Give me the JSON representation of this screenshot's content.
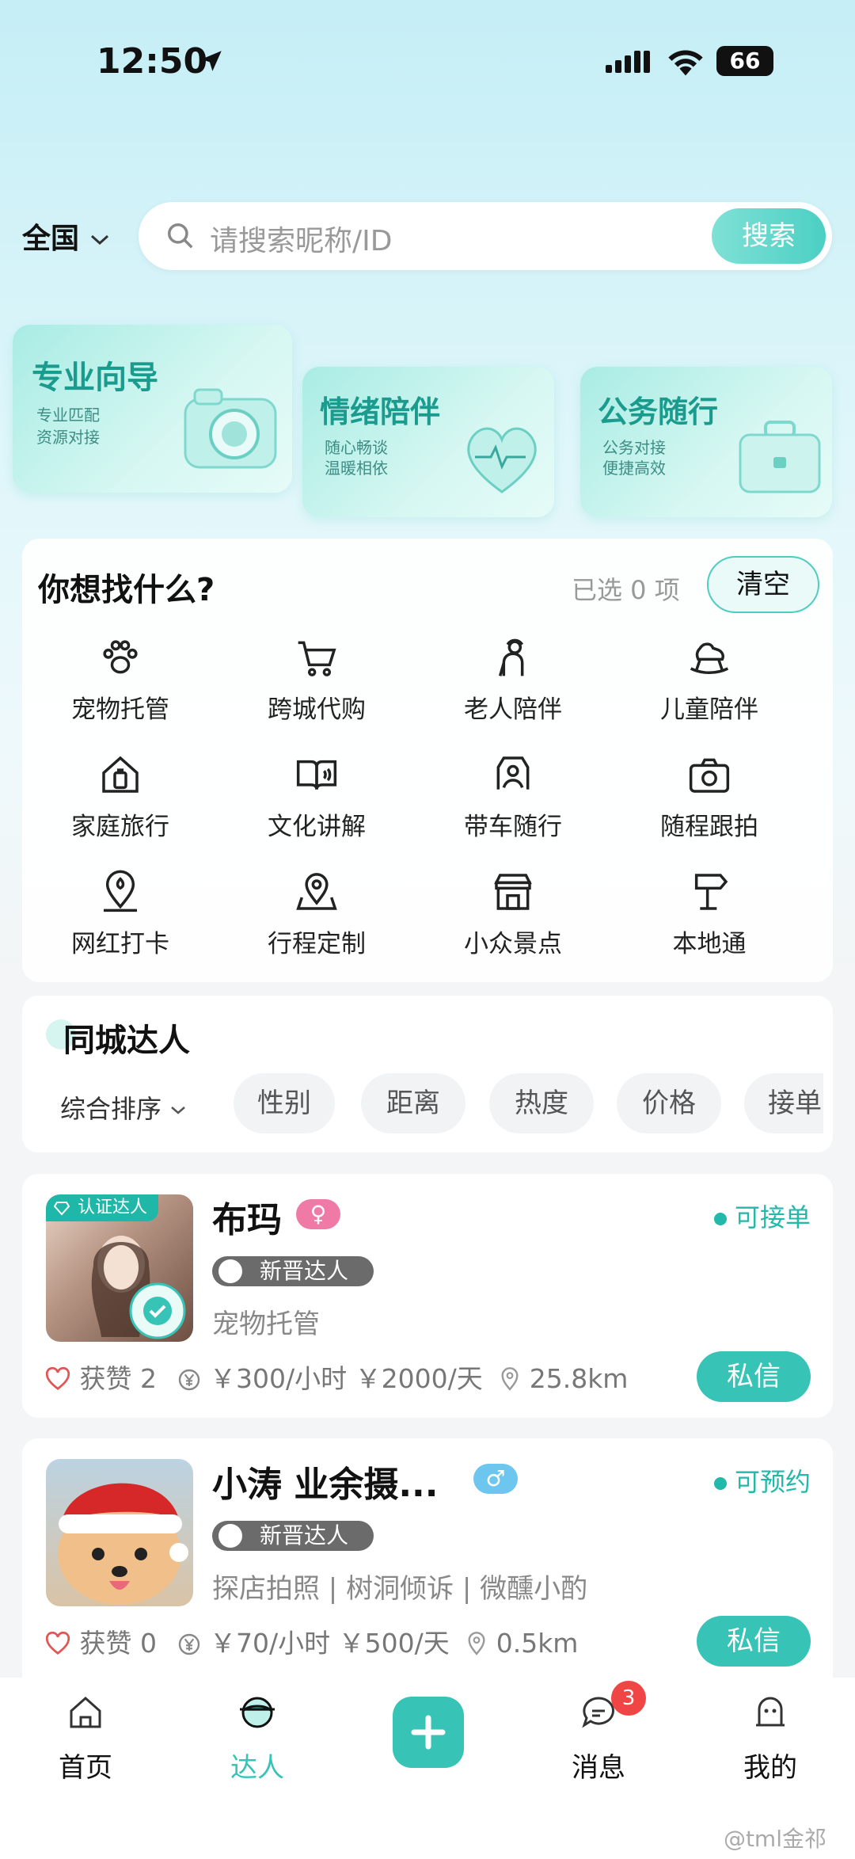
{
  "status_bar": {
    "time": "12:50",
    "battery": "66"
  },
  "header": {
    "city": "全国",
    "search_placeholder": "请搜索昵称/ID",
    "search_button": "搜索"
  },
  "banners": [
    {
      "title": "专业向导",
      "line1": "专业匹配",
      "line2": "资源对接",
      "icon": "camera-icon"
    },
    {
      "title": "情绪陪伴",
      "line1": "随心畅谈",
      "line2": "温暖相依",
      "icon": "heart-icon"
    },
    {
      "title": "公务随行",
      "line1": "公务对接",
      "line2": "便捷高效",
      "icon": "briefcase-icon"
    }
  ],
  "finder": {
    "title": "你想找什么?",
    "selected_text": "已选 0 项",
    "clear_label": "清空",
    "categories": [
      {
        "label": "宠物托管",
        "icon": "paw-icon"
      },
      {
        "label": "跨城代购",
        "icon": "cart-icon"
      },
      {
        "label": "老人陪伴",
        "icon": "elder-icon"
      },
      {
        "label": "儿童陪伴",
        "icon": "rocking-horse-icon"
      },
      {
        "label": "家庭旅行",
        "icon": "home-luggage-icon"
      },
      {
        "label": "文化讲解",
        "icon": "book-icon"
      },
      {
        "label": "带车随行",
        "icon": "car-driver-icon"
      },
      {
        "label": "随程跟拍",
        "icon": "camera-icon"
      },
      {
        "label": "网红打卡",
        "icon": "location-pin-icon"
      },
      {
        "label": "行程定制",
        "icon": "map-pin-icon"
      },
      {
        "label": "小众景点",
        "icon": "shop-icon"
      },
      {
        "label": "本地通",
        "icon": "signpost-icon"
      }
    ]
  },
  "nearby": {
    "title": "同城达人",
    "sort_label": "综合排序",
    "filters": [
      "性别",
      "距离",
      "热度",
      "价格",
      "接单"
    ]
  },
  "users": [
    {
      "name": "布玛",
      "gender": "♀",
      "gender_color": "#f07aa6",
      "status": "可接单",
      "badge": "新晋达人",
      "verified_label": "认证达人",
      "tags": "宠物托管",
      "likes_label": "获赞",
      "likes": "2",
      "price_hour": "￥300/小时",
      "price_day": "￥2000/天",
      "distance": "25.8km",
      "message_label": "私信"
    },
    {
      "name": "小涛 业余摄...",
      "gender": "♂",
      "gender_color": "#6cc6ee",
      "status": "可预约",
      "badge": "新晋达人",
      "tags": "探店拍照 | 树洞倾诉 | 微醺小酌",
      "likes_label": "获赞",
      "likes": "0",
      "price_hour": "￥70/小时",
      "price_day": "￥500/天",
      "distance": "0.5km",
      "message_label": "私信"
    }
  ],
  "tabbar": {
    "home": "首页",
    "experts": "达人",
    "messages": "消息",
    "messages_badge": "3",
    "mine": "我的"
  },
  "watermark": "@tml金祁",
  "colors": {
    "accent": "#37c4b6",
    "accent_light": "#a8ece4"
  }
}
